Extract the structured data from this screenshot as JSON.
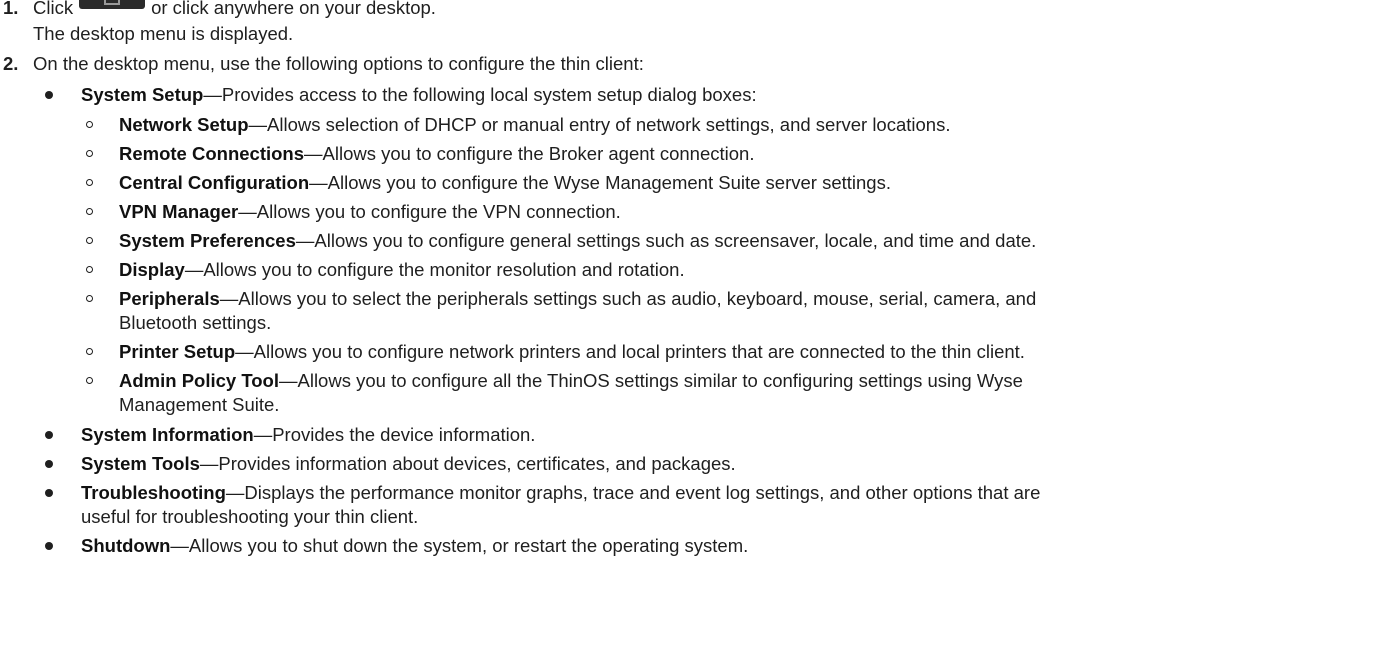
{
  "step1": {
    "number": "1.",
    "text_before": "Click",
    "icon": "desktop-menu-icon",
    "text_after": "or click anywhere on your desktop.",
    "result": "The desktop menu is displayed."
  },
  "step2": {
    "number": "2.",
    "intro": "On the desktop menu, use the following options to configure the thin client:"
  },
  "items": [
    {
      "term": "System Setup",
      "desc": "—Provides access to the following local system setup dialog boxes:"
    },
    {
      "term": "System Information",
      "desc": "—Provides the device information."
    },
    {
      "term": "System Tools",
      "desc": "—Provides information about devices, certificates, and packages."
    },
    {
      "term": "Troubleshooting",
      "desc": "—Displays the performance monitor graphs, trace and event log settings, and other options that are",
      "desc2": "useful for troubleshooting your thin client."
    },
    {
      "term": "Shutdown",
      "desc": "—Allows you to shut down the system, or restart the operating system."
    }
  ],
  "subitems": [
    {
      "term": "Network Setup",
      "desc": "—Allows selection of DHCP or manual entry of network settings, and server locations."
    },
    {
      "term": "Remote Connections",
      "desc": "—Allows you to configure the Broker agent connection."
    },
    {
      "term": "Central Configuration",
      "desc": "—Allows you to configure the Wyse Management Suite server settings."
    },
    {
      "term": "VPN Manager",
      "desc": "—Allows you to configure the VPN connection."
    },
    {
      "term": "System Preferences",
      "desc": "—Allows you to configure general settings such as screensaver, locale, and time and date."
    },
    {
      "term": "Display",
      "desc": "—Allows you to configure the monitor resolution and rotation."
    },
    {
      "term": "Peripherals",
      "desc": "—Allows you to select the peripherals settings such as audio, keyboard, mouse, serial, camera, and",
      "desc2": "Bluetooth settings."
    },
    {
      "term": "Printer Setup",
      "desc": "—Allows you to configure network printers and local printers that are connected to the thin client."
    },
    {
      "term": "Admin Policy Tool",
      "desc": "—Allows you to configure all the ThinOS settings similar to configuring settings using Wyse",
      "desc2": "Management Suite."
    }
  ]
}
